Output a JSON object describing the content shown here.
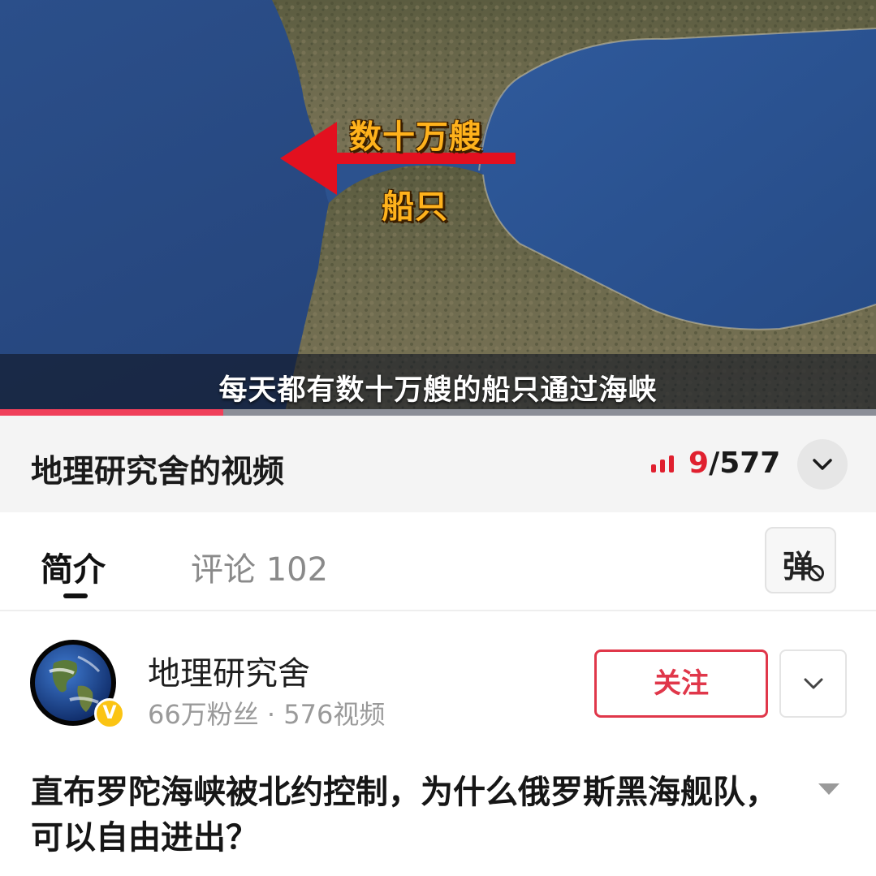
{
  "video": {
    "overlay_label_top": "数十万艘",
    "overlay_label_bottom": "船只",
    "subtitle": "每天都有数十万艘的船只通过海峡",
    "progress": 0.255,
    "colors": {
      "label": "#ffb21c",
      "arrow": "#e3101f",
      "progress": "#f0405a"
    }
  },
  "collection": {
    "title": "地理研究舍的视频",
    "current": "9",
    "total": "/577",
    "current_color": "#e0202f"
  },
  "tabs": {
    "intro": "简介",
    "comments": "评论 102",
    "danmu": "弹"
  },
  "author": {
    "name": "地理研究舍",
    "stats": "66万粉丝 · 576视频",
    "verified_mark": "V",
    "follow_label": "关注",
    "follow_color": "#e0374a"
  },
  "post": {
    "title": "直布罗陀海峡被北约控制，为什么俄罗斯黑海舰队，可以自由进出？"
  },
  "icons": [
    "signal-bars-icon",
    "chevron-down-icon",
    "danmu-off-icon",
    "globe-avatar",
    "verified-badge-icon",
    "caret-down-icon"
  ]
}
